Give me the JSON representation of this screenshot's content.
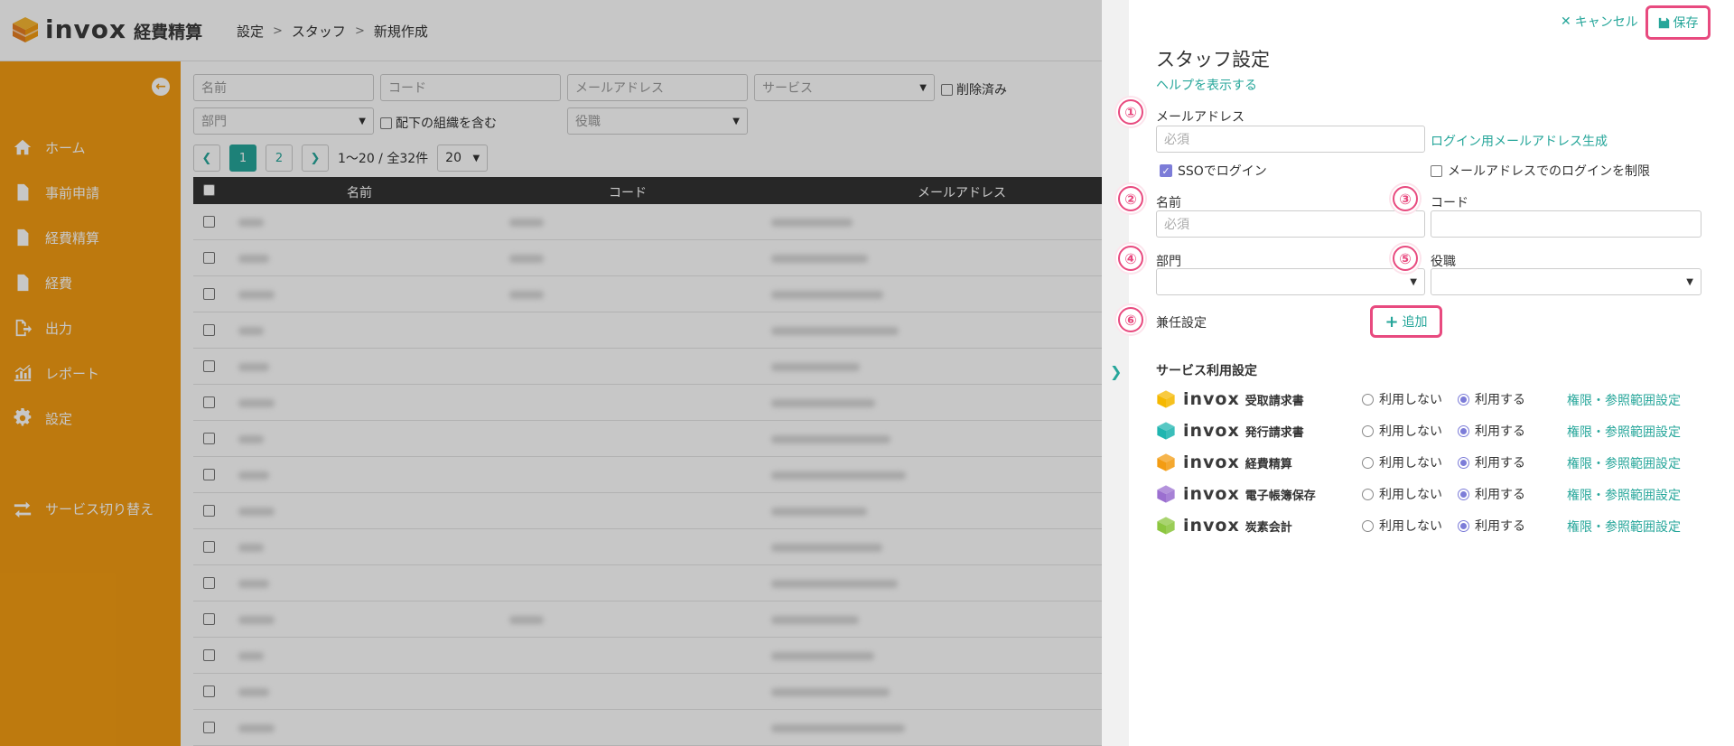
{
  "header": {
    "logo_text": "invox",
    "logo_sub": "経費精算",
    "breadcrumb": [
      "設定",
      "スタッフ",
      "新規作成"
    ]
  },
  "sidebar": {
    "items": [
      {
        "label": "ホーム",
        "icon": "home-icon"
      },
      {
        "label": "事前申請",
        "icon": "document-icon"
      },
      {
        "label": "経費精算",
        "icon": "document-icon"
      },
      {
        "label": "経費",
        "icon": "document-icon"
      },
      {
        "label": "出力",
        "icon": "export-icon"
      },
      {
        "label": "レポート",
        "icon": "chart-icon"
      },
      {
        "label": "設定",
        "icon": "gear-icon"
      },
      {
        "label": "サービス切り替え",
        "icon": "switch-icon"
      }
    ]
  },
  "filters": {
    "name_placeholder": "名前",
    "code_placeholder": "コード",
    "email_placeholder": "メールアドレス",
    "service_placeholder": "サービス",
    "deleted_label": "削除済み",
    "department_placeholder": "部門",
    "include_sub_label": "配下の組織を含む",
    "position_placeholder": "役職"
  },
  "pager": {
    "pages": [
      "1",
      "2"
    ],
    "info": "1〜20 / 全32件",
    "per_page": "20"
  },
  "table": {
    "columns": [
      "名前",
      "コード",
      "メールアドレス"
    ],
    "row_count": 15
  },
  "panel": {
    "cancel_label": "キャンセル",
    "save_label": "保存",
    "title": "スタッフ設定",
    "help_link": "ヘルプを表示する",
    "markers": [
      "①",
      "②",
      "③",
      "④",
      "⑤",
      "⑥"
    ],
    "email_label": "メールアドレス",
    "email_placeholder": "必須",
    "email_gen_link": "ログイン用メールアドレス生成",
    "sso_label": "SSOでログイン",
    "restrict_label": "メールアドレスでのログインを制限",
    "name_label": "名前",
    "name_placeholder": "必須",
    "code_label": "コード",
    "department_label": "部門",
    "position_label": "役職",
    "concurrent_label": "兼任設定",
    "add_label": "追加",
    "services_title": "サービス利用設定",
    "option_off": "利用しない",
    "option_on": "利用する",
    "settings_link": "権限・参照範囲設定",
    "services": [
      {
        "brand": "invox",
        "name": "受取請求書",
        "color": "#f5b800"
      },
      {
        "brand": "invox",
        "name": "発行請求書",
        "color": "#1fb5b0"
      },
      {
        "brand": "invox",
        "name": "経費精算",
        "color": "#f39c12"
      },
      {
        "brand": "invox",
        "name": "電子帳簿保存",
        "color": "#9b6fd0"
      },
      {
        "brand": "invox",
        "name": "炭素会計",
        "color": "#8cc63f"
      }
    ]
  },
  "colors": {
    "sidebar": "#f39c12",
    "accent": "#26a69a",
    "highlight": "#e84a7f"
  }
}
